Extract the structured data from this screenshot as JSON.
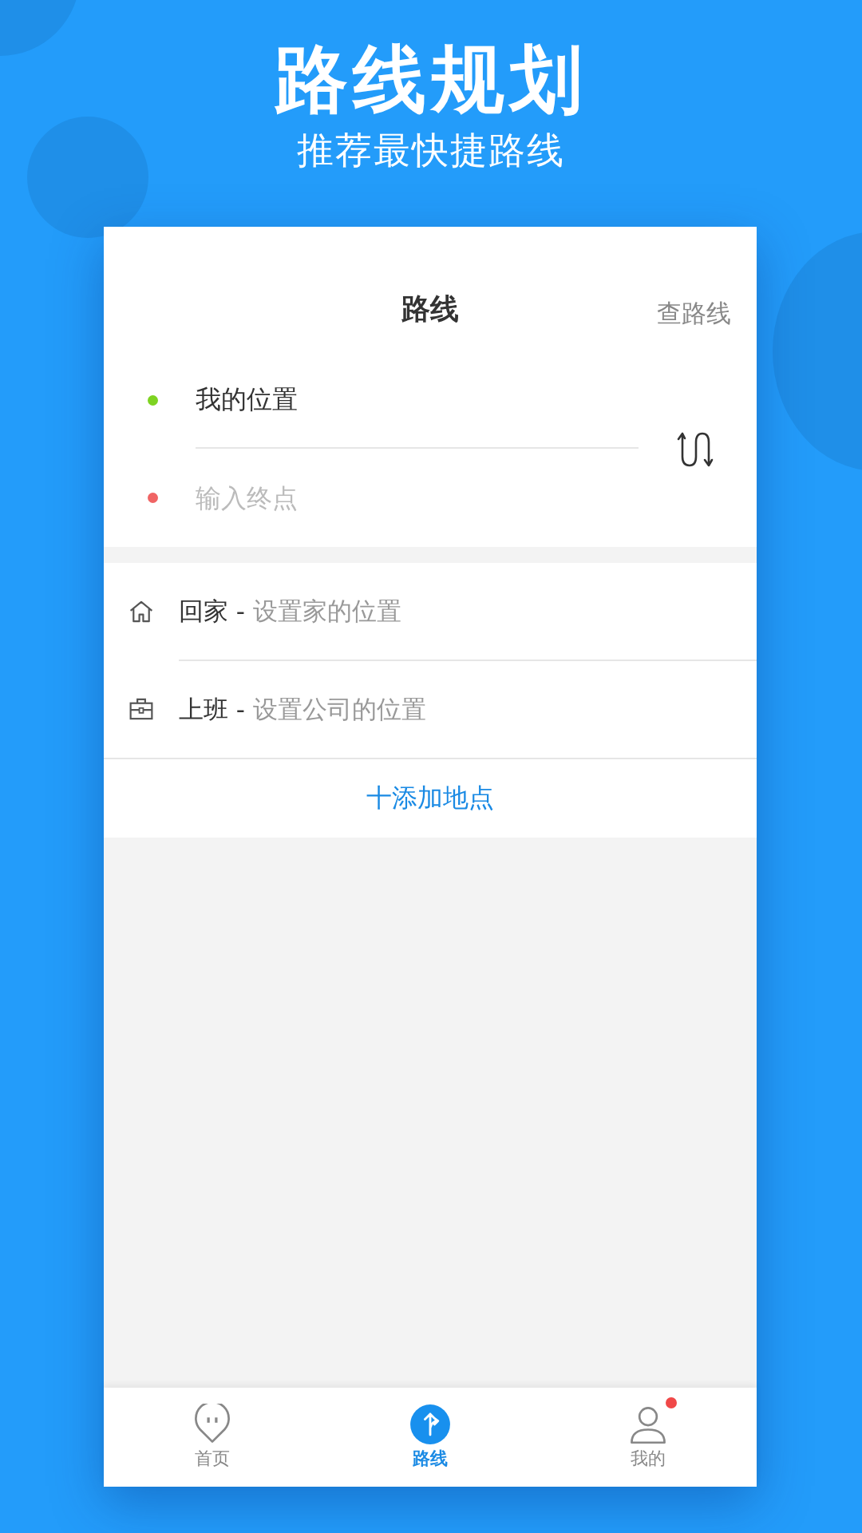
{
  "banner": {
    "title": "路线规划",
    "subtitle": "推荐最快捷路线"
  },
  "header": {
    "title": "路线",
    "action": "查路线"
  },
  "route": {
    "stops": [
      {
        "kind": "start",
        "value": "我的位置",
        "color": "#7ed321"
      },
      {
        "kind": "end",
        "placeholder": "输入终点",
        "color": "#f06464"
      }
    ]
  },
  "shortcuts": [
    {
      "kind": "home",
      "label": "回家",
      "separator": "-",
      "hint": "设置家的位置"
    },
    {
      "kind": "work",
      "label": "上班",
      "separator": "-",
      "hint": "设置公司的位置"
    }
  ],
  "add_place": "十添加地点",
  "tabs": [
    {
      "kind": "home",
      "label": "首页",
      "selected": false,
      "badge": false
    },
    {
      "kind": "route",
      "label": "路线",
      "selected": true,
      "badge": false
    },
    {
      "kind": "profile",
      "label": "我的",
      "selected": false,
      "badge": true
    }
  ]
}
